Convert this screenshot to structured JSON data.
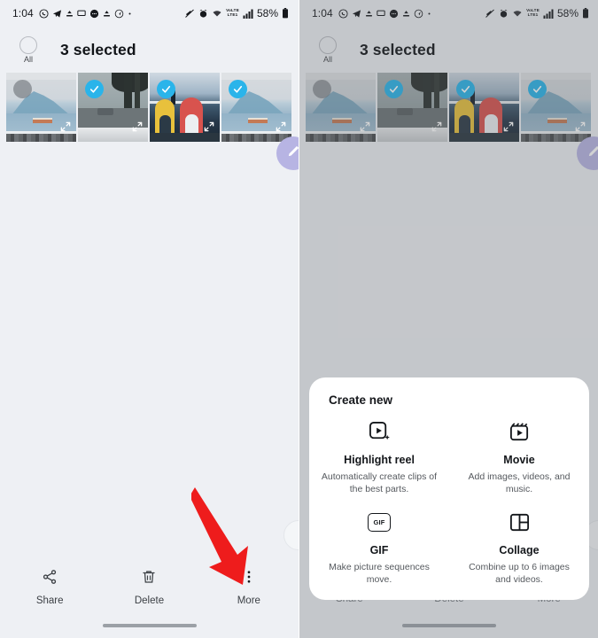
{
  "statusbar": {
    "time": "1:04",
    "left_icons": [
      "whatsapp-icon",
      "telegram-icon",
      "upload-icon",
      "message-icon",
      "chat-icon",
      "upload-icon-2",
      "compass-icon",
      "dot-icon"
    ],
    "right_icons": [
      "mute-icon",
      "alarm-icon",
      "wifi-icon",
      "volte-icon",
      "signal-icon"
    ],
    "volte_top": "VoLTE",
    "volte_bottom": "LTE1",
    "battery": "58%"
  },
  "header": {
    "all_label": "All",
    "selected_text": "3 selected"
  },
  "thumbnails": [
    {
      "name": "thumbnail-1",
      "selected": false,
      "scene": "sceneA"
    },
    {
      "name": "thumbnail-2",
      "selected": true,
      "scene": "sceneB"
    },
    {
      "name": "thumbnail-3",
      "selected": true,
      "scene": "sceneC"
    },
    {
      "name": "thumbnail-4",
      "selected": true,
      "scene": "sceneA"
    }
  ],
  "fab": {
    "icon": "edit-pencil-icon",
    "color": "#b7b4e3"
  },
  "actionbar": {
    "share": {
      "label": "Share",
      "icon": "share-icon"
    },
    "delete": {
      "label": "Delete",
      "icon": "trash-icon"
    },
    "more": {
      "label": "More",
      "icon": "more-vertical-icon"
    }
  },
  "annotation": {
    "arrow": "red-arrow-pointing-to-more",
    "color": "#ee1c1c"
  },
  "sheet": {
    "title": "Create new",
    "items": [
      {
        "icon": "highlight-reel-icon",
        "name": "Highlight reel",
        "desc": "Automatically create clips of the best parts."
      },
      {
        "icon": "movie-clapperboard-icon",
        "name": "Movie",
        "desc": "Add images, videos, and music."
      },
      {
        "icon": "gif-icon",
        "icon_text": "GIF",
        "name": "GIF",
        "desc": "Make picture sequences move."
      },
      {
        "icon": "collage-grid-icon",
        "name": "Collage",
        "desc": "Combine up to 6 images and videos."
      }
    ]
  },
  "colors": {
    "background": "#eef0f4",
    "dimmed_background": "#c4c6c8",
    "accent_blue": "#2ab4ea",
    "arrow_red": "#ee1c1c",
    "fab_purple": "#b7b4e3"
  }
}
